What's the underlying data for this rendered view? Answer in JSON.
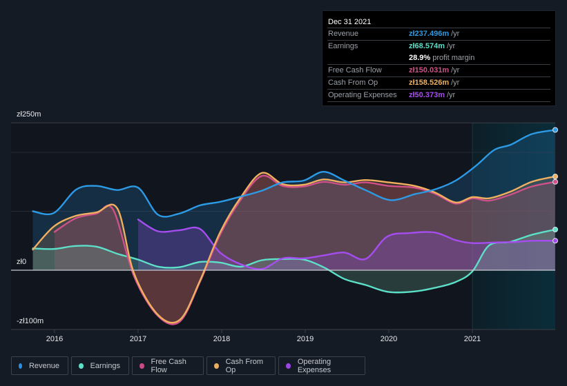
{
  "tooltip": {
    "date": "Dec 31 2021",
    "rows": [
      {
        "label": "Revenue",
        "value": "zł237.496m",
        "unit": "/yr",
        "color": "#2d9ae5"
      },
      {
        "label": "Earnings",
        "value": "zł68.574m",
        "unit": "/yr",
        "color": "#5de0c8"
      },
      {
        "label": "",
        "value": "28.9%",
        "unit": "profit margin",
        "color": "#ffffff"
      },
      {
        "label": "Free Cash Flow",
        "value": "zł150.031m",
        "unit": "/yr",
        "color": "#d0508a"
      },
      {
        "label": "Cash From Op",
        "value": "zł158.526m",
        "unit": "/yr",
        "color": "#f0b060"
      },
      {
        "label": "Operating Expenses",
        "value": "zł50.373m",
        "unit": "/yr",
        "color": "#a64df0"
      }
    ]
  },
  "legend": [
    {
      "label": "Revenue",
      "color": "#2d8ee0"
    },
    {
      "label": "Earnings",
      "color": "#5de0c8"
    },
    {
      "label": "Free Cash Flow",
      "color": "#c84a86"
    },
    {
      "label": "Cash From Op",
      "color": "#e8ad5e"
    },
    {
      "label": "Operating Expenses",
      "color": "#9b45e6"
    }
  ],
  "chart_data": {
    "type": "area",
    "title": "",
    "xlabel": "",
    "ylabel": "",
    "y_tick_labels": [
      "zł250m",
      "zł0",
      "-zł100m"
    ],
    "x_tick_labels": [
      "2016",
      "2017",
      "2018",
      "2019",
      "2020",
      "2021"
    ],
    "x_ticks": [
      2016,
      2017,
      2018,
      2019,
      2020,
      2021
    ],
    "xlim": [
      2015.75,
      2022.0
    ],
    "ylim": [
      -100,
      250
    ],
    "gridlines": [
      250,
      200,
      100,
      0
    ],
    "highlight_start": 2021.0,
    "legend_position": "bottom",
    "series": [
      {
        "name": "Revenue",
        "color": "#2d9ae5",
        "x": [
          2015.74,
          2015.99,
          2016.26,
          2016.5,
          2016.75,
          2017.0,
          2017.24,
          2017.49,
          2017.74,
          2017.98,
          2018.23,
          2018.48,
          2018.73,
          2018.98,
          2019.22,
          2019.47,
          2019.72,
          2020.02,
          2020.31,
          2020.55,
          2020.8,
          2021.05,
          2021.26,
          2021.46,
          2021.71,
          2021.99
        ],
        "y": [
          100,
          97,
          137,
          143,
          136,
          140,
          94,
          96,
          110,
          116,
          125,
          135,
          149,
          152,
          167,
          152,
          136,
          119,
          129,
          137,
          152,
          178,
          204,
          213,
          231,
          238
        ]
      },
      {
        "name": "Earnings",
        "color": "#5de0c8",
        "x": [
          2015.74,
          2015.99,
          2016.24,
          2016.5,
          2016.75,
          2017.0,
          2017.24,
          2017.49,
          2017.74,
          2017.98,
          2018.23,
          2018.48,
          2018.73,
          2018.98,
          2019.22,
          2019.47,
          2019.72,
          2020.0,
          2020.31,
          2020.55,
          2020.8,
          2021.0,
          2021.2,
          2021.45,
          2021.71,
          2021.99
        ],
        "y": [
          37,
          36,
          41,
          40,
          28,
          18,
          6,
          5,
          14,
          13,
          6,
          17,
          19,
          18,
          5,
          -15,
          -25,
          -37,
          -36,
          -30,
          -20,
          -2,
          42,
          48,
          60,
          69
        ]
      },
      {
        "name": "Free Cash Flow",
        "color": "#d0508a",
        "x": [
          2016.0,
          2016.25,
          2016.5,
          2016.7,
          2016.95,
          2017.24,
          2017.5,
          2017.74,
          2017.98,
          2018.23,
          2018.48,
          2018.73,
          2018.98,
          2019.22,
          2019.47,
          2019.72,
          2020.0,
          2020.31,
          2020.55,
          2020.8,
          2021.0,
          2021.2,
          2021.45,
          2021.71,
          2021.99
        ],
        "y": [
          65,
          88,
          96,
          103,
          -10,
          -78,
          -87,
          -20,
          60,
          120,
          160,
          143,
          142,
          150,
          145,
          149,
          143,
          140,
          130,
          113,
          122,
          118,
          128,
          142,
          150
        ]
      },
      {
        "name": "Cash From Op",
        "color": "#f0b060",
        "x": [
          2015.74,
          2015.99,
          2016.25,
          2016.5,
          2016.75,
          2016.95,
          2017.24,
          2017.5,
          2017.74,
          2017.98,
          2018.23,
          2018.48,
          2018.73,
          2018.98,
          2019.22,
          2019.47,
          2019.72,
          2020.0,
          2020.31,
          2020.55,
          2020.8,
          2021.0,
          2021.2,
          2021.45,
          2021.71,
          2021.99
        ],
        "y": [
          35,
          74,
          92,
          98,
          105,
          -5,
          -76,
          -84,
          -18,
          64,
          124,
          165,
          146,
          145,
          154,
          149,
          153,
          149,
          143,
          132,
          115,
          124,
          122,
          133,
          150,
          159
        ]
      },
      {
        "name": "Operating Expenses",
        "color": "#a64df0",
        "x": [
          2017.0,
          2017.24,
          2017.5,
          2017.74,
          2017.98,
          2018.23,
          2018.48,
          2018.73,
          2018.98,
          2019.22,
          2019.47,
          2019.72,
          2019.98,
          2020.25,
          2020.55,
          2020.8,
          2021.0,
          2021.26,
          2021.52,
          2021.71,
          2021.99
        ],
        "y": [
          86,
          66,
          68,
          70,
          30,
          10,
          2,
          20,
          20,
          25,
          30,
          19,
          57,
          63,
          64,
          51,
          46,
          47,
          48,
          50,
          50
        ]
      }
    ]
  }
}
